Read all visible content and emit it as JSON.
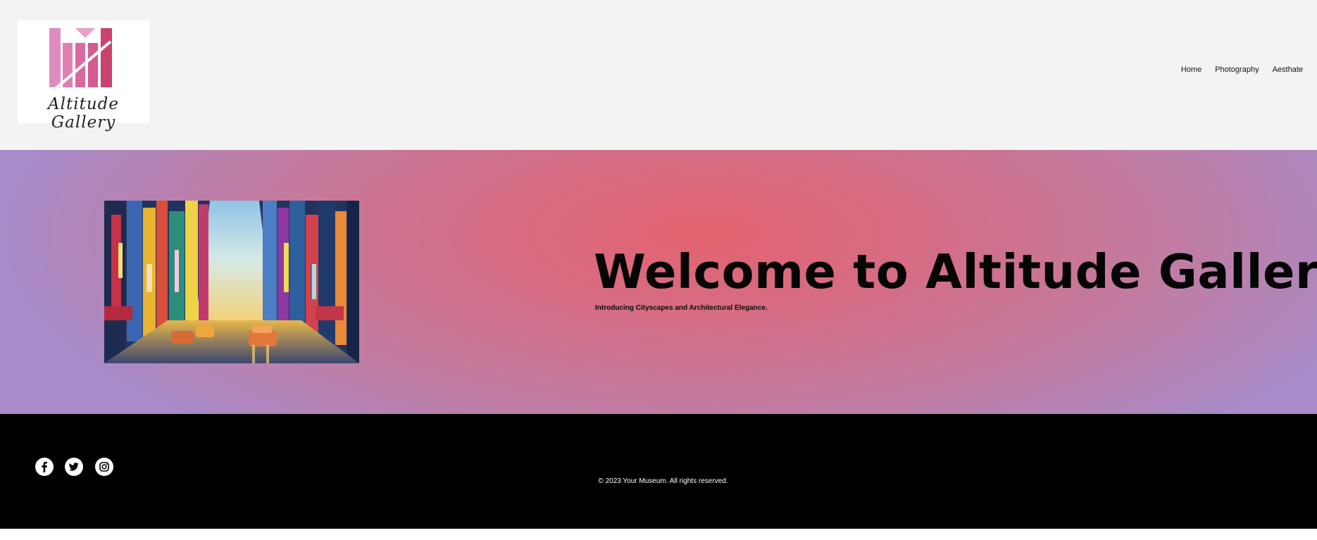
{
  "brand": {
    "logo_text": "Altitude Gallery",
    "logo_colors": [
      "#e08bbf",
      "#d95f95",
      "#c8436f"
    ]
  },
  "nav": {
    "items": [
      {
        "label": "Home"
      },
      {
        "label": "Photography"
      },
      {
        "label": "Aesthate"
      }
    ]
  },
  "hero": {
    "title": "Welcome to Altitude Gallery",
    "subtitle": "Introducing Cityscapes and Architectural Elegance.",
    "image_subject": "colorful cityscape painting with taxis"
  },
  "footer": {
    "social": [
      {
        "icon": "facebook-icon"
      },
      {
        "icon": "twitter-icon"
      },
      {
        "icon": "instagram-icon"
      }
    ],
    "copyright": "© 2023 Your Museum. All rights reserved."
  },
  "colors": {
    "header_bg": "#f3f3f3",
    "hero_center": "#e3636e",
    "hero_edge": "#a88bc8",
    "footer_bg": "#000000"
  }
}
